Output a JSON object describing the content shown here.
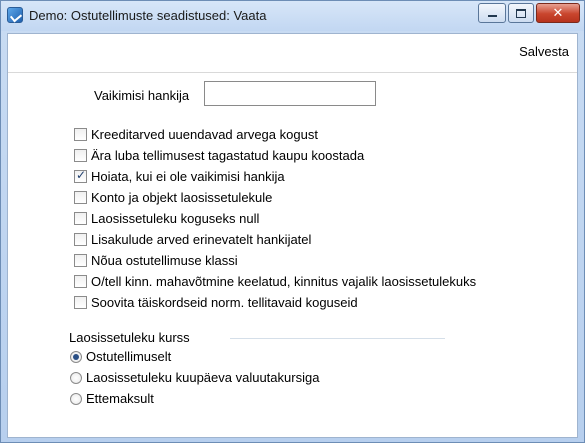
{
  "window": {
    "title": "Demo: Ostutellimuste seadistused: Vaata",
    "buttons": {
      "minimize": "minimize",
      "maximize": "maximize",
      "close": "✕"
    }
  },
  "toolbar": {
    "save_label": "Salvesta"
  },
  "default_supplier": {
    "label": "Vaikimisi hankija",
    "value": ""
  },
  "checkboxes": [
    {
      "label": "Kreeditarved uuendavad arvega kogust",
      "checked": false
    },
    {
      "label": "Ära luba tellimusest tagastatud kaupu koostada",
      "checked": false
    },
    {
      "label": "Hoiata, kui ei ole vaikimisi hankija",
      "checked": true
    },
    {
      "label": "Konto ja objekt laosissetulekule",
      "checked": false
    },
    {
      "label": "Laosissetuleku koguseks null",
      "checked": false
    },
    {
      "label": "Lisakulude arved erinevatelt hankijatel",
      "checked": false
    },
    {
      "label": "Nõua ostutellimuse klassi",
      "checked": false
    },
    {
      "label": "O/tell kinn. mahavõtmine keelatud, kinnitus vajalik laosissetulekuks",
      "checked": false
    },
    {
      "label": "Soovita täiskordseid norm. tellitavaid koguseid",
      "checked": false
    }
  ],
  "rate_group": {
    "title": "Laosissetuleku kurss",
    "options": [
      {
        "label": "Ostutellimuselt",
        "selected": true
      },
      {
        "label": "Laosissetuleku kuupäeva valuutakursiga",
        "selected": false
      },
      {
        "label": "Ettemaksult",
        "selected": false
      }
    ]
  },
  "colors": {
    "titlebar": "#c9dcf3",
    "close_button": "#c9452d",
    "check_mark": "#1f3f6e"
  }
}
